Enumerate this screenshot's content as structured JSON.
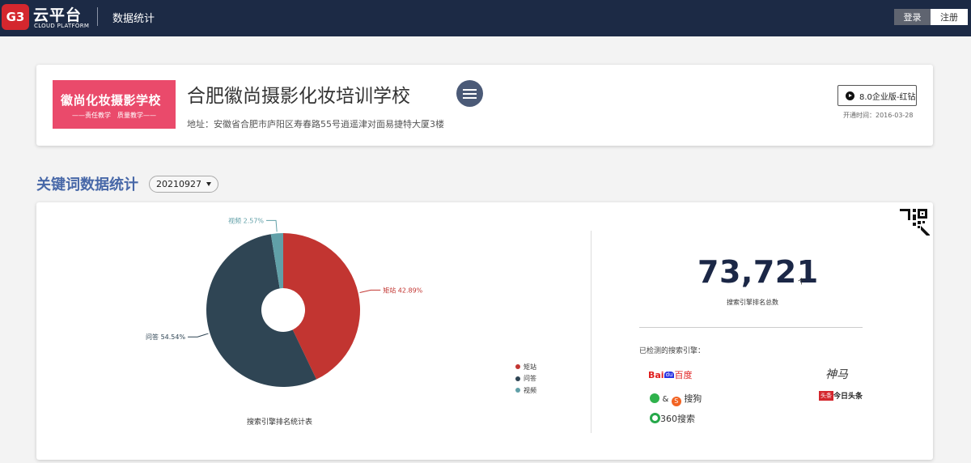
{
  "header": {
    "logo_mark": "G3",
    "logo_title": "云平台",
    "logo_subtitle": "CLOUD PLATFORM",
    "nav_title": "数据统计",
    "login_label": "登录",
    "register_label": "注册"
  },
  "school": {
    "logo_text": "徽尚化妆摄影学校",
    "logo_slogan": "——责任教学　质量教学——",
    "name": "合肥徽尚摄影化妆培训学校",
    "address": "地址：安徽省合肥市庐阳区寿春路55号逍遥津对面易捷特大厦3楼",
    "edition": "8.0企业版-红钻",
    "open_date": "开通时间：2016-03-28"
  },
  "stats": {
    "section_title": "关键词数据统计",
    "date_value": "20210927",
    "chart_title": "搜索引擎排名统计表",
    "total_number": "73,721",
    "total_unit": "个",
    "total_label": "搜索引擎排名总数",
    "engines_label": "已检测的搜索引擎：",
    "engines": {
      "baidu": "百度",
      "shenma": "神马",
      "sogou": "搜狗",
      "toutiao": "今日头条",
      "so360": "360搜索"
    }
  },
  "chart_data": {
    "type": "pie",
    "title": "搜索引擎排名统计表",
    "series": [
      {
        "name": "矩站",
        "value": 42.89,
        "label": "矩站  42.89%",
        "color": "#c23531"
      },
      {
        "name": "问答",
        "value": 54.54,
        "label": "问答  54.54%",
        "color": "#2f4554"
      },
      {
        "name": "视频",
        "value": 2.57,
        "label": "视频  2.57%",
        "color": "#61a0a8"
      }
    ],
    "legend_position": "right-bottom"
  }
}
